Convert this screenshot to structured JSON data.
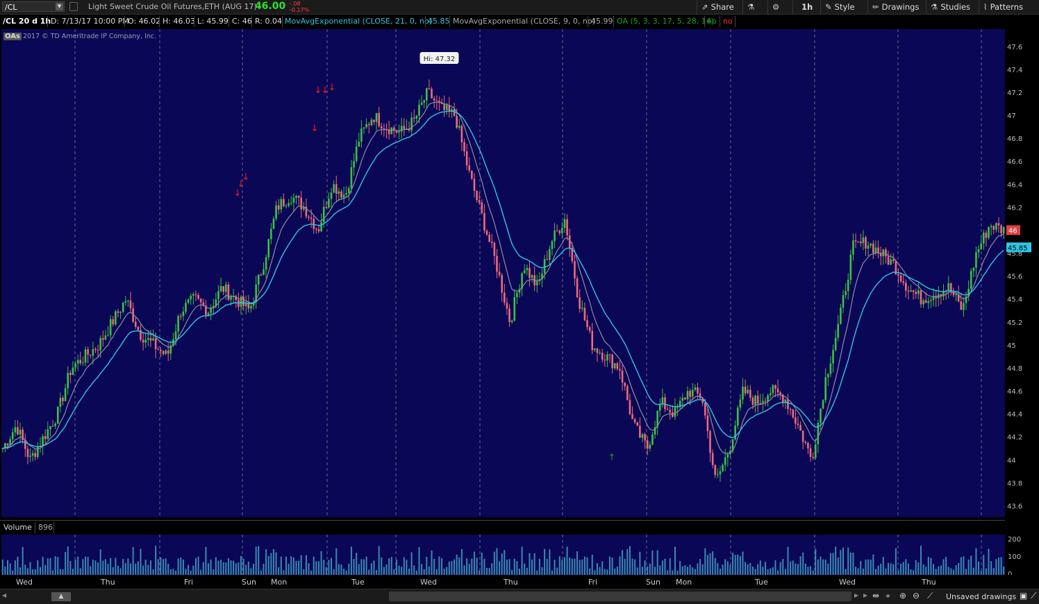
{
  "toolbar": {
    "symbol": "/CL",
    "description": "Light Sweet Crude Oil Futures,ETH (AUG 17)",
    "last": "46.00",
    "change": "-.08",
    "change_pct": "-0.17%",
    "buttons": [
      {
        "label": "Share",
        "icon": "share-icon"
      },
      {
        "label": "",
        "icon": "flask-icon"
      },
      {
        "label": "",
        "icon": "gear-icon"
      },
      {
        "label": "1h",
        "icon": ""
      },
      {
        "label": "Style",
        "icon": "style-icon"
      },
      {
        "label": "Drawings",
        "icon": "pencil-icon"
      },
      {
        "label": "Studies",
        "icon": "flask-icon"
      },
      {
        "label": "Patterns",
        "icon": "patterns-icon"
      }
    ]
  },
  "info": {
    "chart_id": "/CL 20 d 1h",
    "date": "D: 7/13/17 10:00 PM",
    "open": "O: 46.02",
    "high": "H: 46.03",
    "low": "L: 45.99",
    "close": "C: 46",
    "range": "R: 0.04",
    "ema21_label": "MovAvgExponential (CLOSE, 21, 0, no)",
    "ema21_value": "45.85",
    "ema9_label": "MovAvgExponential (CLOSE, 9, 0, no)",
    "ema9_value": "45.99",
    "oa_label": "OA (5, 3, 3, 17, 5, 28, 14)",
    "oa_no1": "no",
    "oa_no2": "no"
  },
  "copyright": {
    "badge": "OAs",
    "text": "2017 © TD Ameritrade IP Company, Inc."
  },
  "volume": {
    "label": "Volume",
    "value": "896"
  },
  "footer": {
    "unsaved": "Unsaved drawings"
  },
  "colors": {
    "background": "#0a0756",
    "up": "#3ec23e",
    "down": "#f06a7a",
    "ema21": "#2ec6e6",
    "ema9": "#8e8e9e",
    "arrow_sell": "#ff1a1a",
    "arrow_buy": "#14a014",
    "volume": "#3a8ab0"
  },
  "chart_data": {
    "type": "candlestick",
    "y_range": [
      43.5,
      47.75
    ],
    "y_ticks": [
      "47.6",
      "47.4",
      "47.2",
      "47",
      "46.8",
      "46.6",
      "46.4",
      "46.2",
      "46",
      "45.8",
      "45.6",
      "45.4",
      "45.2",
      "45",
      "44.8",
      "44.6",
      "44.4",
      "44.2",
      "44",
      "43.8",
      "43.6"
    ],
    "x_labels": [
      "Wed",
      "Thu",
      "Fri",
      "Sun",
      "Mon",
      "Tue",
      "Wed",
      "Thu",
      "Fri",
      "Sun",
      "Mon",
      "Tue",
      "Wed",
      "Thu"
    ],
    "high_annotation": "Hi: 47.32",
    "last_price_label": "46",
    "ema21_price_label": "45.85",
    "close_path": [
      44.1,
      44.3,
      44.0,
      44.2,
      44.4,
      44.8,
      44.9,
      45.0,
      45.2,
      45.4,
      45.1,
      45.0,
      44.9,
      45.3,
      45.4,
      45.3,
      45.5,
      45.4,
      45.3,
      45.7,
      46.2,
      46.3,
      46.2,
      46.0,
      46.4,
      46.3,
      46.8,
      47.0,
      46.9,
      46.85,
      46.95,
      47.2,
      47.05,
      47.0,
      46.5,
      46.1,
      45.7,
      45.2,
      45.7,
      45.5,
      45.9,
      46.1,
      45.4,
      45.0,
      44.9,
      44.8,
      44.3,
      44.1,
      44.5,
      44.4,
      44.6,
      44.55,
      43.8,
      44.1,
      44.6,
      44.5,
      44.6,
      44.55,
      44.3,
      44.0,
      44.7,
      45.2,
      45.85,
      45.9,
      45.8,
      45.7,
      45.5,
      45.4,
      45.45,
      45.5,
      45.3,
      45.8,
      46.05,
      46.0
    ],
    "volume_ticks": [
      "200",
      "100",
      "0"
    ]
  }
}
